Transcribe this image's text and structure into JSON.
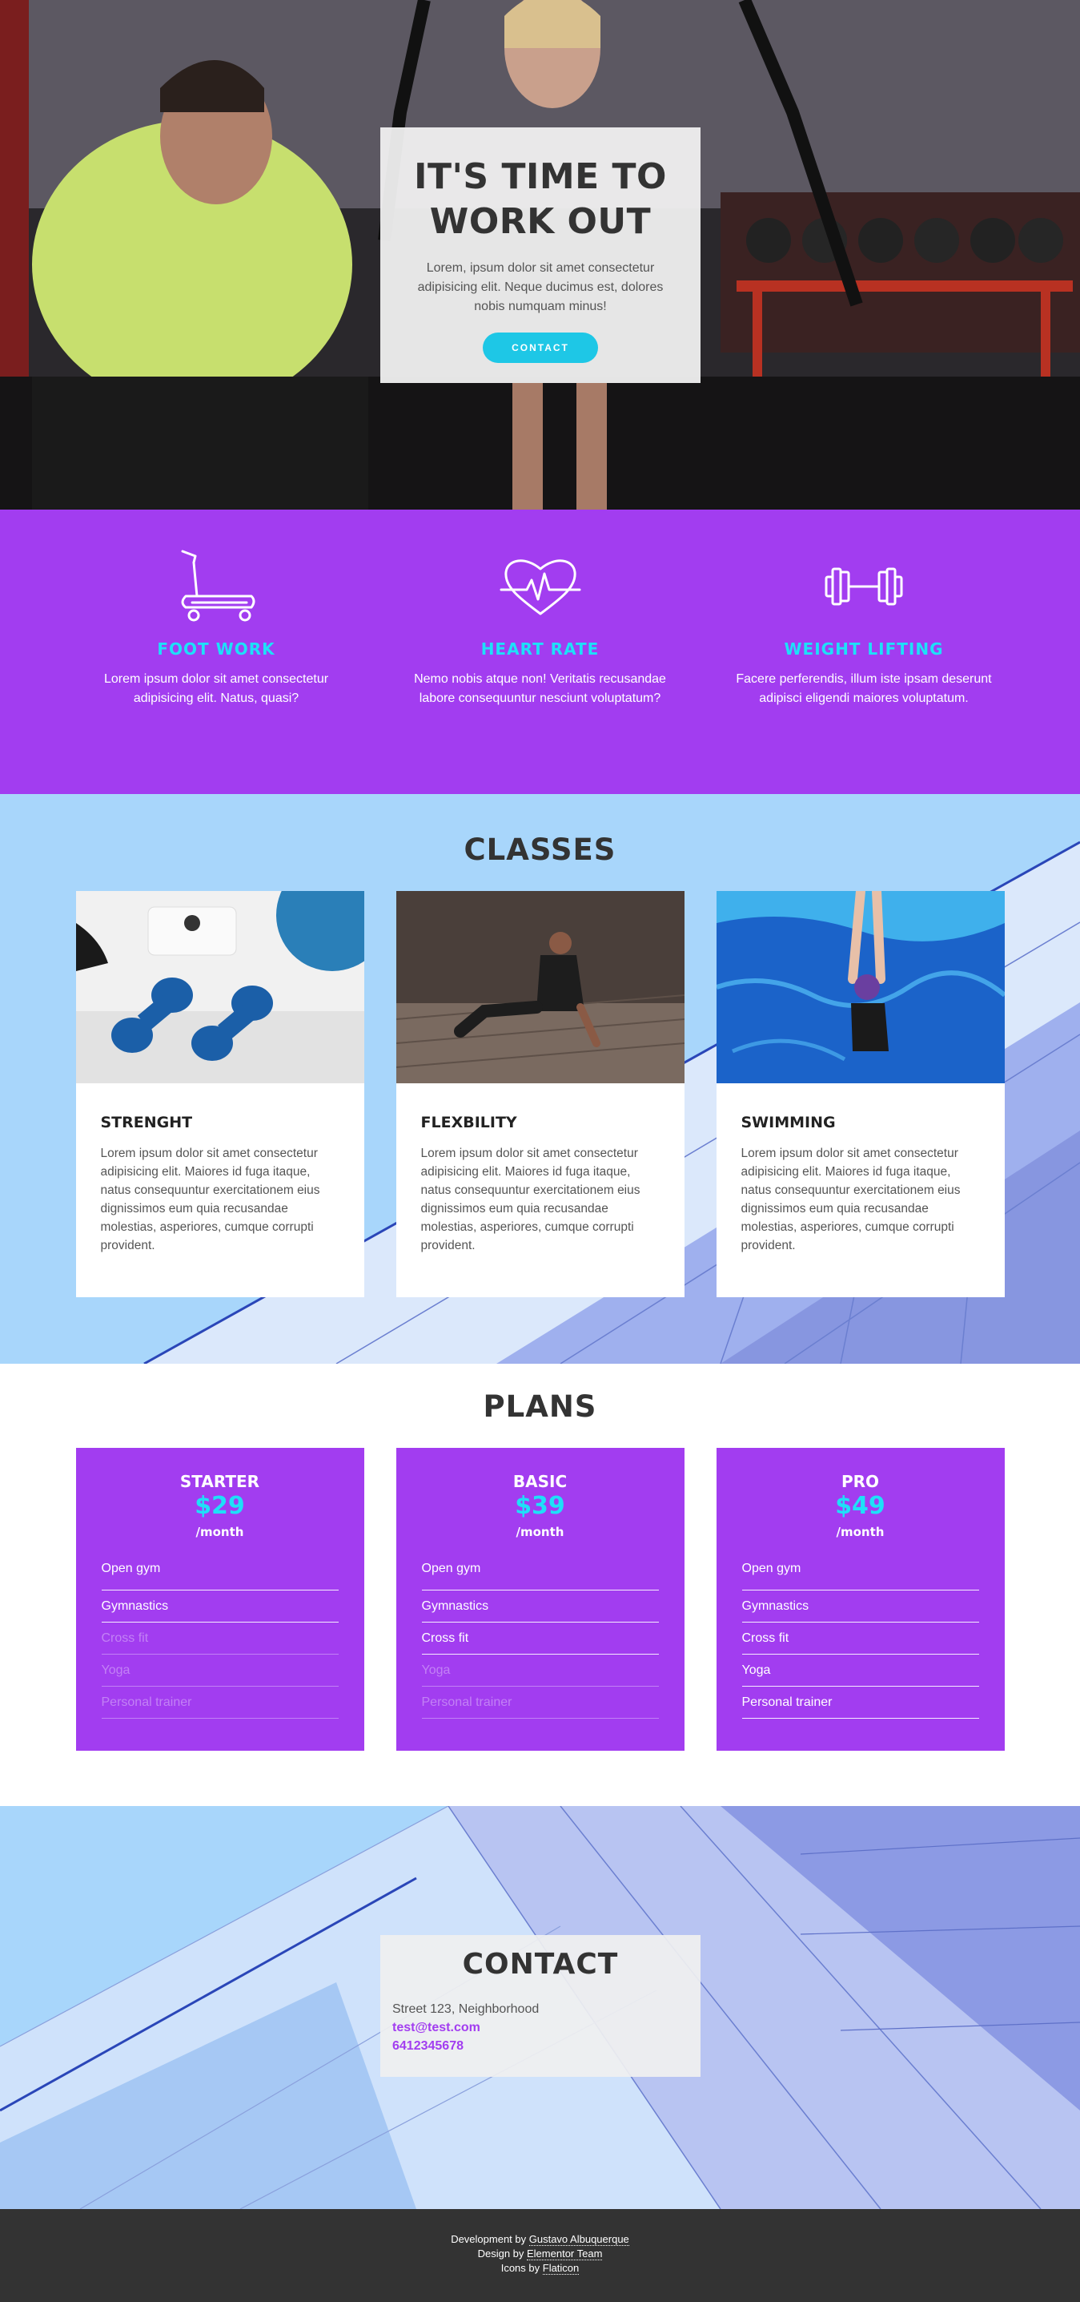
{
  "hero": {
    "title_line1": "IT'S TIME TO",
    "title_line2": "WORK OUT",
    "text": "Lorem, ipsum dolor sit amet consectetur adipisicing elit. Neque ducimus est, dolores nobis numquam minus!",
    "button_label": "CONTACT"
  },
  "features": [
    {
      "icon": "treadmill-icon",
      "title": "FOOT WORK",
      "text": "Lorem ipsum dolor sit amet consectetur adipisicing elit. Natus, quasi?"
    },
    {
      "icon": "heart-rate-icon",
      "title": "HEART RATE",
      "text": "Nemo nobis atque non! Veritatis recusandae labore consequuntur nesciunt voluptatum?"
    },
    {
      "icon": "dumbbell-icon",
      "title": "WEIGHT LIFTING",
      "text": "Facere perferendis, illum iste ipsam deserunt adipisci eligendi maiores voluptatum."
    }
  ],
  "classes": {
    "title": "CLASSES",
    "items": [
      {
        "title": "STRENGHT",
        "text": "Lorem ipsum dolor sit amet consectetur adipisicing elit. Maiores id fuga itaque, natus consequuntur exercitationem eius dignissimos eum quia recusandae molestias, asperiores, cumque corrupti provident."
      },
      {
        "title": "FLEXBILITY",
        "text": "Lorem ipsum dolor sit amet consectetur adipisicing elit. Maiores id fuga itaque, natus consequuntur exercitationem eius dignissimos eum quia recusandae molestias, asperiores, cumque corrupti provident."
      },
      {
        "title": "SWIMMING",
        "text": "Lorem ipsum dolor sit amet consectetur adipisicing elit. Maiores id fuga itaque, natus consequuntur exercitationem eius dignissimos eum quia recusandae molestias, asperiores, cumque corrupti provident."
      }
    ]
  },
  "plans": {
    "title": "PLANS",
    "items": [
      {
        "name": "STARTER",
        "price": "$29",
        "period": "/month",
        "features": [
          "Open gym",
          "Gymnastics",
          "Cross fit",
          "Yoga",
          "Personal trainer"
        ],
        "included": [
          true,
          true,
          false,
          false,
          false
        ]
      },
      {
        "name": "BASIC",
        "price": "$39",
        "period": "/month",
        "features": [
          "Open gym",
          "Gymnastics",
          "Cross fit",
          "Yoga",
          "Personal trainer"
        ],
        "included": [
          true,
          true,
          true,
          false,
          false
        ]
      },
      {
        "name": "PRO",
        "price": "$49",
        "period": "/month",
        "features": [
          "Open gym",
          "Gymnastics",
          "Cross fit",
          "Yoga",
          "Personal trainer"
        ],
        "included": [
          true,
          true,
          true,
          true,
          true
        ]
      }
    ]
  },
  "contact": {
    "title": "CONTACT",
    "address": "Street 123, Neighborhood",
    "email": "test@test.com",
    "phone": "6412345678"
  },
  "footer": {
    "dev_prefix": "Development by ",
    "dev_name": "Gustavo Albuquerque",
    "design_prefix": "Design by ",
    "design_name": "Elementor Team",
    "icons_prefix": "Icons by ",
    "icons_name": "Flaticon"
  },
  "colors": {
    "purple": "#a23df0",
    "cyan": "#1ee0f8",
    "button": "#1ec7e6",
    "dark": "#333333"
  }
}
